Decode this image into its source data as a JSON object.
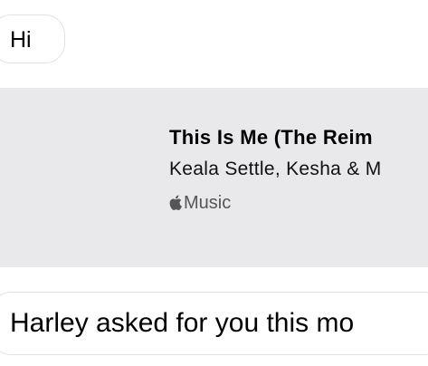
{
  "conversation": {
    "messages": [
      {
        "text": "Hi"
      },
      {
        "text": "Harley asked for you this mo"
      }
    ],
    "music_card": {
      "title": "This Is Me (The Reim",
      "artist": "Keala Settle, Kesha & M",
      "service": "Music",
      "service_icon": "apple-logo-icon"
    }
  },
  "colors": {
    "card_background": "#e9e9eb",
    "bubble_border": "#e1e1e1"
  }
}
